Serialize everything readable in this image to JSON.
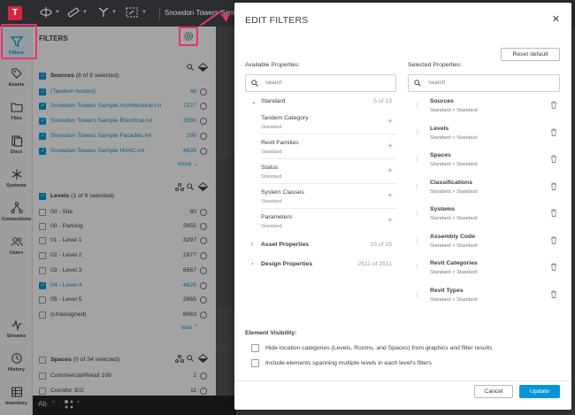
{
  "topbar": {
    "project_title": "Snowdon Towers Sample"
  },
  "rail": [
    {
      "label": "Filters",
      "icon": "filter-icon",
      "active": true
    },
    {
      "label": "Assets",
      "icon": "tag-icon"
    },
    {
      "label": "Files",
      "icon": "folder-icon"
    },
    {
      "label": "Docs",
      "icon": "document-icon"
    },
    {
      "label": "Systems",
      "icon": "systems-icon"
    },
    {
      "label": "Connections",
      "icon": "connections-icon"
    },
    {
      "label": "Users",
      "icon": "users-icon"
    },
    {
      "label": "Streams",
      "icon": "streams-icon"
    },
    {
      "label": "History",
      "icon": "history-icon"
    },
    {
      "label": "Inventory",
      "icon": "inventory-icon"
    }
  ],
  "filters": {
    "title": "FILTERS",
    "sources": {
      "header": "Sources",
      "count": "(8 of 8 selected)",
      "items": [
        {
          "name": "(Tandem hosted)",
          "count": "48"
        },
        {
          "name": "Snowdon Towers Sample Architectural.rvt",
          "count": "7227"
        },
        {
          "name": "Snowdon Towers Sample Electrical.rvt",
          "count": "3290"
        },
        {
          "name": "Snowdon Towers Sample Facades.rvt",
          "count": "295"
        },
        {
          "name": "Snowdon Towers Sample HVAC.rvt",
          "count": "4639"
        }
      ],
      "more": "more"
    },
    "levels": {
      "header": "Levels",
      "count": "(1 of 8 selected)",
      "items": [
        {
          "name": "00 - Site",
          "count": "80",
          "checked": false
        },
        {
          "name": "00 - Parking",
          "count": "2655",
          "checked": false
        },
        {
          "name": "01 - Level 1",
          "count": "3297",
          "checked": false
        },
        {
          "name": "02 - Level 2",
          "count": "2977",
          "checked": false
        },
        {
          "name": "03 - Level 3",
          "count": "6567",
          "checked": false
        },
        {
          "name": "04 - Level 4",
          "count": "4828",
          "checked": true
        },
        {
          "name": "05 - Level 5",
          "count": "2865",
          "checked": false
        },
        {
          "name": "(Unassigned)",
          "count": "6063",
          "checked": false
        }
      ],
      "less": "less"
    },
    "spaces": {
      "header": "Spaces",
      "count": "(0 of 34 selected)",
      "items": [
        {
          "name": "Commercial/Retail 109",
          "count": "2"
        },
        {
          "name": "Corridor 302",
          "count": "11"
        }
      ]
    }
  },
  "statusbar": {
    "text_style": "Ab"
  },
  "modal": {
    "title": "EDIT FILTERS",
    "reset_label": "Reset default",
    "available_label": "Available Properties:",
    "selected_label": "Selected Properties:",
    "search_placeholder": "Search",
    "standard": {
      "title": "Standard",
      "count": "5 of 13"
    },
    "standard_items": [
      {
        "name": "Tandem Category",
        "sub": "Standard"
      },
      {
        "name": "Revit Families",
        "sub": "Standard"
      },
      {
        "name": "Status",
        "sub": "Standard"
      },
      {
        "name": "System Classes",
        "sub": "Standard"
      },
      {
        "name": "Parameters",
        "sub": "Standard"
      }
    ],
    "asset_properties": {
      "title": "Asset Properties",
      "count": "15 of 15"
    },
    "design_properties": {
      "title": "Design Properties",
      "count": "2511 of 2511"
    },
    "selected_items": [
      {
        "name": "Sources",
        "sub": "Standard > Standard"
      },
      {
        "name": "Levels",
        "sub": "Standard > Standard"
      },
      {
        "name": "Spaces",
        "sub": "Standard > Standard"
      },
      {
        "name": "Classifications",
        "sub": "Standard > Standard"
      },
      {
        "name": "Systems",
        "sub": "Standard > Standard"
      },
      {
        "name": "Assembly Code",
        "sub": "Standard > Standard"
      },
      {
        "name": "Revit Categories",
        "sub": "Standard > Standard"
      },
      {
        "name": "Revit Types",
        "sub": "Standard > Standard"
      }
    ],
    "visibility_label": "Element Visibility:",
    "visibility_options": [
      "Hide location categories (Levels, Rooms, and Spaces) from graphics and filter results",
      "Include elements spanning multiple levels in each level's filters"
    ],
    "cancel_label": "Cancel",
    "update_label": "Update"
  }
}
